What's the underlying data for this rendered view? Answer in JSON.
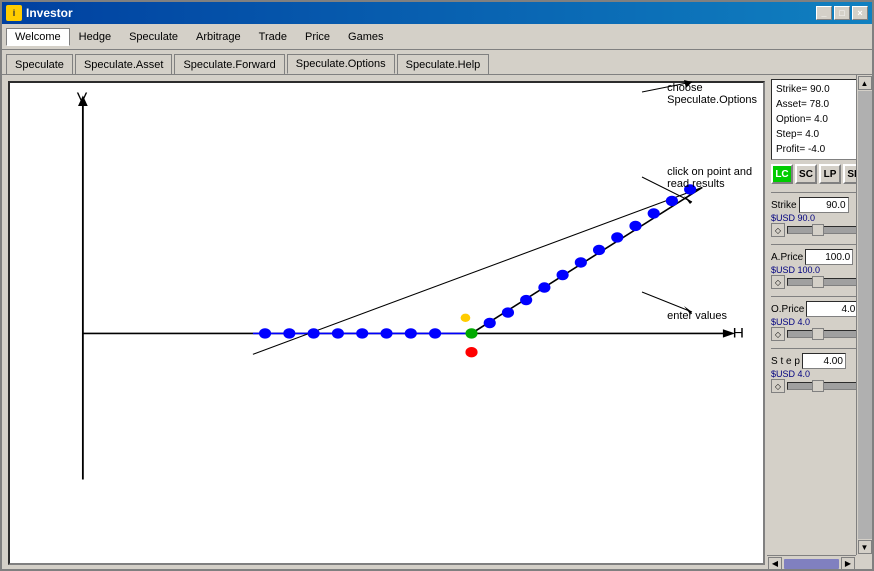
{
  "window": {
    "title": "Investor",
    "controls": [
      "_",
      "□",
      "×"
    ]
  },
  "menubar": {
    "items": [
      "Welcome",
      "Hedge",
      "Speculate",
      "Arbitrage",
      "Trade",
      "Price",
      "Games"
    ],
    "active": "Welcome"
  },
  "tabs": {
    "items": [
      "Speculate",
      "Speculate.Asset",
      "Speculate.Forward",
      "Speculate.Options",
      "Speculate.Help"
    ],
    "active": "Speculate.Options"
  },
  "info": {
    "strike": "Strike= 90.0",
    "asset": "Asset= 78.0",
    "option": "Option= 4.0",
    "step": "Step= 4.0",
    "profit": "Profit= -4.0"
  },
  "buttons": {
    "lc": "LC",
    "sc": "SC",
    "lp": "LP",
    "sp": "SP"
  },
  "fields": {
    "strike": {
      "label": "Strike",
      "value": "90.0",
      "usd_label": "$USD 90.0"
    },
    "aprice": {
      "label": "A.Price",
      "value": "100.0",
      "usd_label": "$USD 100.0"
    },
    "oprice": {
      "label": "O.Price",
      "value": "4.0",
      "usd_label": "$USD 4.0"
    },
    "step": {
      "label": "S t e p",
      "value": "4.00",
      "usd_label": "$USD 4.0"
    }
  },
  "annotations": {
    "choose": "choose",
    "choose_sub": "Speculate.Options",
    "click": "click on point and",
    "click_sub": "read results",
    "enter": "enter values"
  },
  "axes": {
    "v_label": "V",
    "h_label": "H"
  }
}
